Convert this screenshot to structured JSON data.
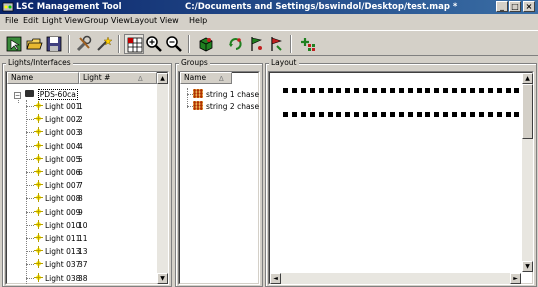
{
  "window": {
    "app_title": "LSC Management Tool",
    "doc_title": "C:/Documents and Settings/bswindol/Desktop/test.map *",
    "minimize": "_",
    "maximize": "□",
    "close": "×"
  },
  "menu": [
    "File",
    "Edit",
    "Light View",
    "Group View",
    "Layout View",
    "Help"
  ],
  "toolbar": {
    "buttons": [
      "select-icon",
      "open-icon",
      "save-icon",
      "tools-icon",
      "wand-icon",
      "grid-icon",
      "zoom-in-icon",
      "zoom-out-icon",
      "cube-icon",
      "rotate-icon",
      "flag-left-icon",
      "flag-right-icon",
      "add-light-icon"
    ]
  },
  "lights_panel": {
    "title": "Lights/Interfaces",
    "columns": [
      "Name",
      "Light #"
    ],
    "sort_indicator": "∆",
    "root": "PDS-60ca",
    "lights": [
      {
        "name": "Light 001",
        "num": "1"
      },
      {
        "name": "Light 002",
        "num": "2"
      },
      {
        "name": "Light 003",
        "num": "3"
      },
      {
        "name": "Light 004",
        "num": "4"
      },
      {
        "name": "Light 005",
        "num": "5"
      },
      {
        "name": "Light 006",
        "num": "6"
      },
      {
        "name": "Light 007",
        "num": "7"
      },
      {
        "name": "Light 008",
        "num": "8"
      },
      {
        "name": "Light 009",
        "num": "9"
      },
      {
        "name": "Light 010",
        "num": "10"
      },
      {
        "name": "Light 011",
        "num": "11"
      },
      {
        "name": "Light 013",
        "num": "13"
      },
      {
        "name": "Light 037",
        "num": "37"
      },
      {
        "name": "Light 038",
        "num": "38"
      }
    ]
  },
  "groups_panel": {
    "title": "Groups",
    "columns": [
      "Name"
    ],
    "sort_indicator": "∆",
    "groups": [
      "string 1 chase",
      "string 2 chase"
    ]
  },
  "layout_panel": {
    "title": "Layout",
    "led_rows": 2,
    "leds_per_row": 28
  },
  "scroll": {
    "up": "▲",
    "down": "▼",
    "left": "◄",
    "right": "►"
  }
}
